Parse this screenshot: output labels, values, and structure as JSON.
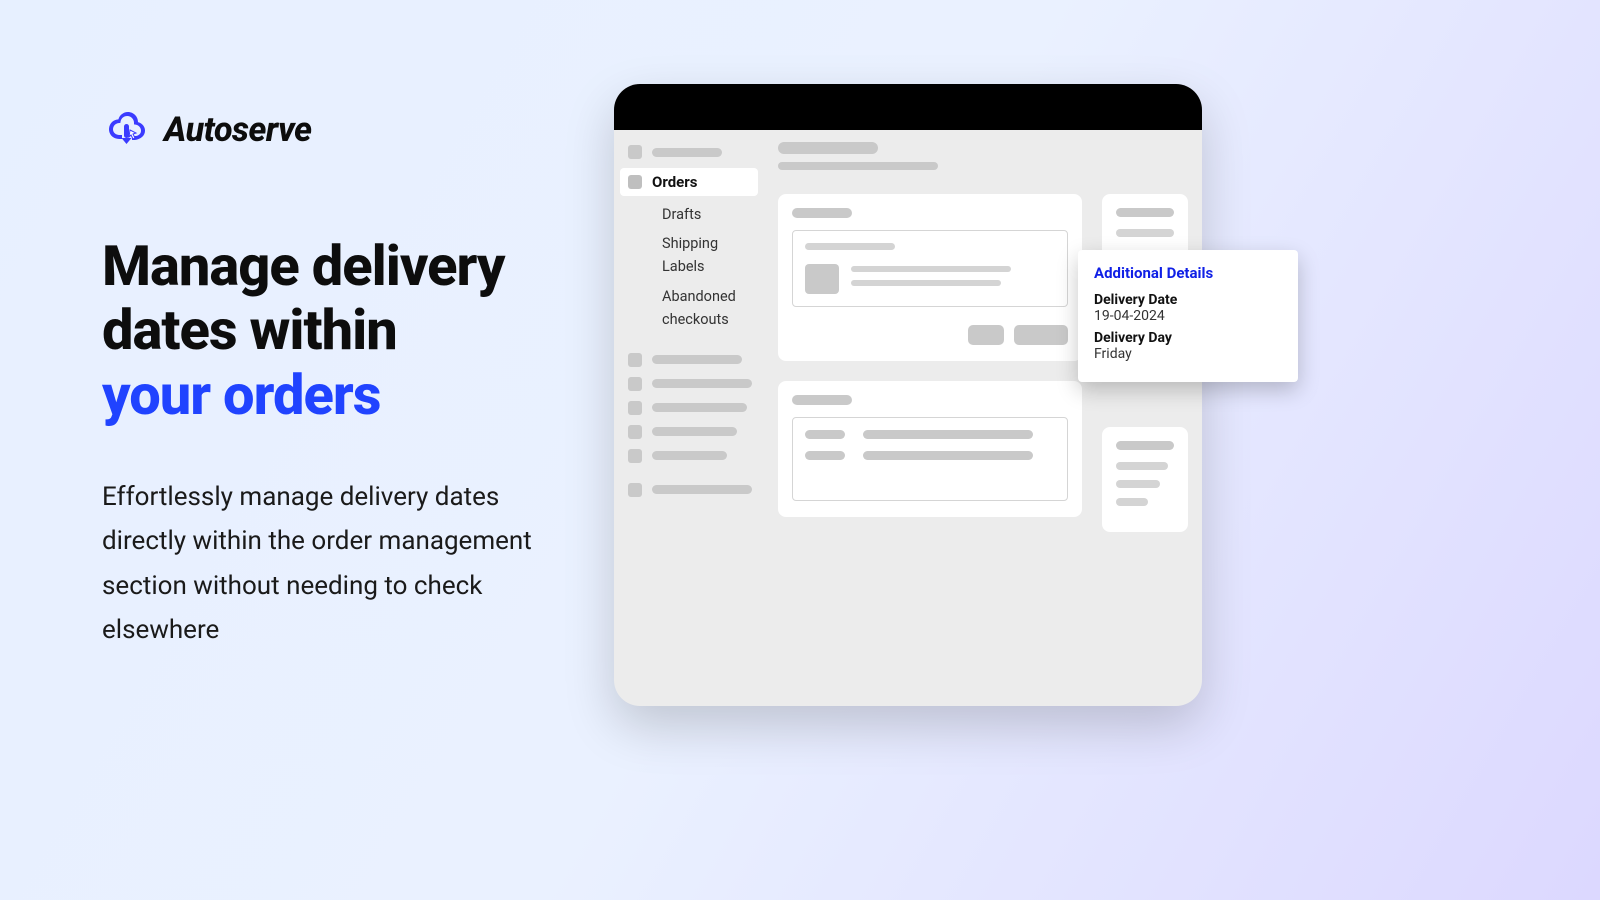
{
  "brand": {
    "name": "Autoserve"
  },
  "hero": {
    "headline_line1": "Manage delivery",
    "headline_line2": "dates within",
    "headline_accent": "your orders",
    "subtext": "Effortlessly manage delivery dates directly within the order management section without needing to check elsewhere"
  },
  "sidebar": {
    "active_label": "Orders",
    "subitems": [
      "Drafts",
      "Shipping Labels",
      "Abandoned checkouts"
    ]
  },
  "popout": {
    "title": "Additional Details",
    "date_label": "Delivery Date",
    "date_value": "19-04-2024",
    "day_label": "Delivery Day",
    "day_value": "Friday"
  },
  "colors": {
    "accent": "#2043ff"
  }
}
